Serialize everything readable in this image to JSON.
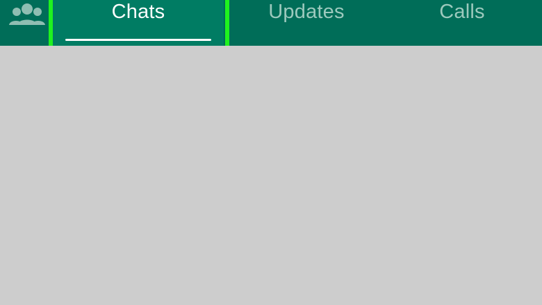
{
  "tabs": {
    "community_icon": "community-icon",
    "items": [
      {
        "label": "Chats",
        "active": true
      },
      {
        "label": "Updates",
        "active": false
      },
      {
        "label": "Calls",
        "active": false
      }
    ]
  },
  "annotation": {
    "highlight_target": "Chats",
    "highlight_color": "#1ff21f"
  },
  "colors": {
    "tabbar": "#006d58",
    "active_tab": "#007c63",
    "inactive_text": "#9cc9bd",
    "active_text": "#ffffff",
    "content_background": "#cdcdcd"
  }
}
